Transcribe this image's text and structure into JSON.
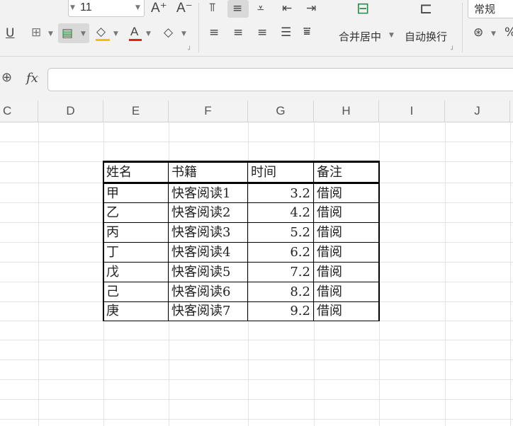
{
  "toolbar": {
    "font_size": "11",
    "merge_center_label": "合并居中",
    "wrap_text_label": "自动换行",
    "number_format": "常规",
    "font_grow_icon": "A⁺",
    "font_shrink_icon": "A⁻"
  },
  "formula_bar": {
    "fx_label": "fx",
    "value": ""
  },
  "columns": [
    "C",
    "D",
    "E",
    "F",
    "G",
    "H",
    "I",
    "J"
  ],
  "table": {
    "headers": [
      "姓名",
      "书籍",
      "时间",
      "备注"
    ],
    "rows": [
      [
        "甲",
        "快客阅读1",
        "3.2",
        "借阅"
      ],
      [
        "乙",
        "快客阅读2",
        "4.2",
        "借阅"
      ],
      [
        "丙",
        "快客阅读3",
        "5.2",
        "借阅"
      ],
      [
        "丁",
        "快客阅读4",
        "6.2",
        "借阅"
      ],
      [
        "戊",
        "快客阅读5",
        "7.2",
        "借阅"
      ],
      [
        "己",
        "快客阅读6",
        "8.2",
        "借阅"
      ],
      [
        "庚",
        "快客阅读7",
        "9.2",
        "借阅"
      ]
    ]
  },
  "colors": {
    "font_color_underline": "#e02020",
    "fill_color_underline": "#f0c000"
  }
}
